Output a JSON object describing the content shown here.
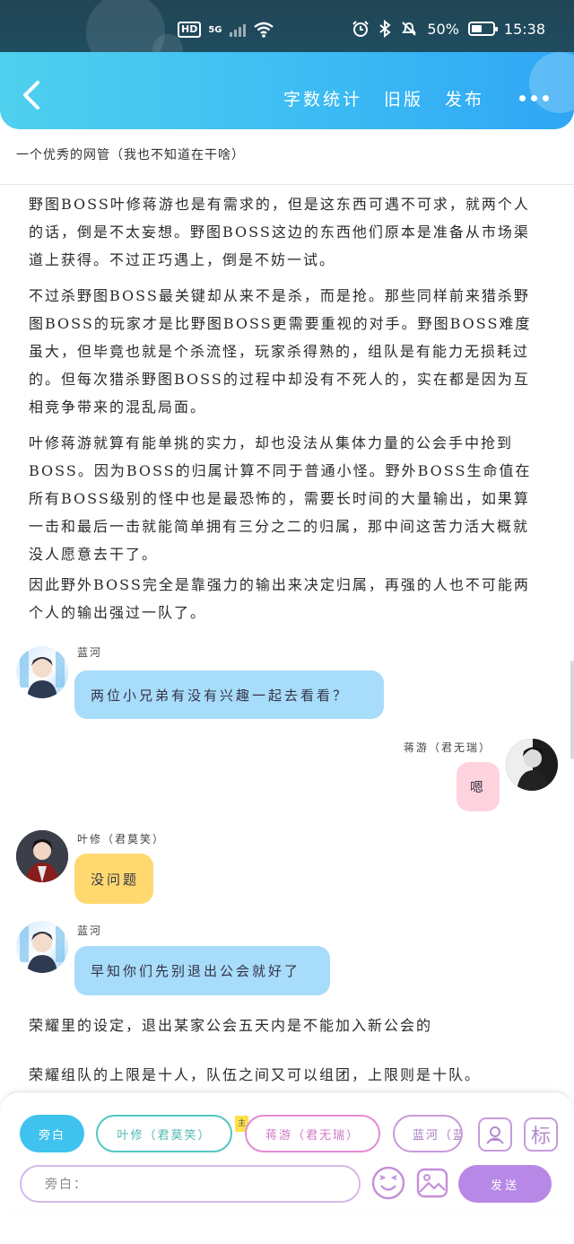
{
  "status_bar": {
    "hd": "HD",
    "network": "5G",
    "battery_text": "50%",
    "battery_level": 0.5,
    "time": "15:38"
  },
  "header": {
    "links": [
      "字数统计",
      "旧版",
      "发布"
    ],
    "back_icon": "chevron-left-icon",
    "more_icon": "more-dots-icon"
  },
  "subtitle": "一个优秀的网管（我也不知道在干啥）",
  "paragraphs": [
    "野图BOSS叶修蒋游也是有需求的，但是这东西可遇不可求，就两个人的话，倒是不太妄想。野图BOSS这边的东西他们原本是准备从市场渠道上获得。不过正巧遇上，倒是不妨一试。",
    "不过杀野图BOSS最关键却从来不是杀，而是抢。那些同样前来猎杀野图BOSS的玩家才是比野图BOSS更需要重视的对手。野图BOSS难度虽大，但毕竟也就是个杀流怪，玩家杀得熟的，组队是有能力无损耗过的。但每次猎杀野图BOSS的过程中却没有不死人的，实在都是因为互相竞争带来的混乱局面。",
    "叶修蒋游就算有能单挑的实力，却也没法从集体力量的公会手中抢到BOSS。因为BOSS的归属计算不同于普通小怪。野外BOSS生命值在所有BOSS级别的怪中也是最恐怖的，需要长时间的大量输出，如果算一击和最后一击就能简单拥有三分之二的归属，那中间这苦力活大概就没人愿意去干了。",
    "因此野外BOSS完全是靠强力的输出来决定归属，再强的人也不可能两个人的输出强过一队了。"
  ],
  "messages": [
    {
      "name": "蓝河",
      "text": "两位小兄弟有没有兴趣一起去看看？"
    },
    {
      "name": "蒋游（君无瑞）",
      "text": "嗯"
    },
    {
      "name": "叶修（君莫笑）",
      "text": "没问题"
    },
    {
      "name": "蓝河",
      "text": "早知你们先别退出公会就好了"
    }
  ],
  "narration": [
    "荣耀里的设定，退出某家公会五天内是不能加入新公会的",
    "荣耀组队的上限是十人，队伍之间又可以组团，上限则是十队。"
  ],
  "role_chips": [
    "旁白",
    "叶修（君莫笑）",
    "蒋游（君无瑞）",
    "蓝河（蓝"
  ],
  "chip_tag": "主",
  "tool_buttons": {
    "profile_icon": "character-card-icon",
    "mark_label": "标"
  },
  "input": {
    "placeholder": "旁白："
  },
  "actions": {
    "emoji_icon": "emoji-icon",
    "image_icon": "image-icon",
    "send_label": "发送"
  },
  "colors": {
    "header_start": "#4fd0ee",
    "header_end": "#2fa6f4",
    "bubble_blue": "#a8dcfb",
    "bubble_pink": "#ffd3de",
    "bubble_yellow": "#ffd970",
    "send_button": "#b788e6"
  }
}
